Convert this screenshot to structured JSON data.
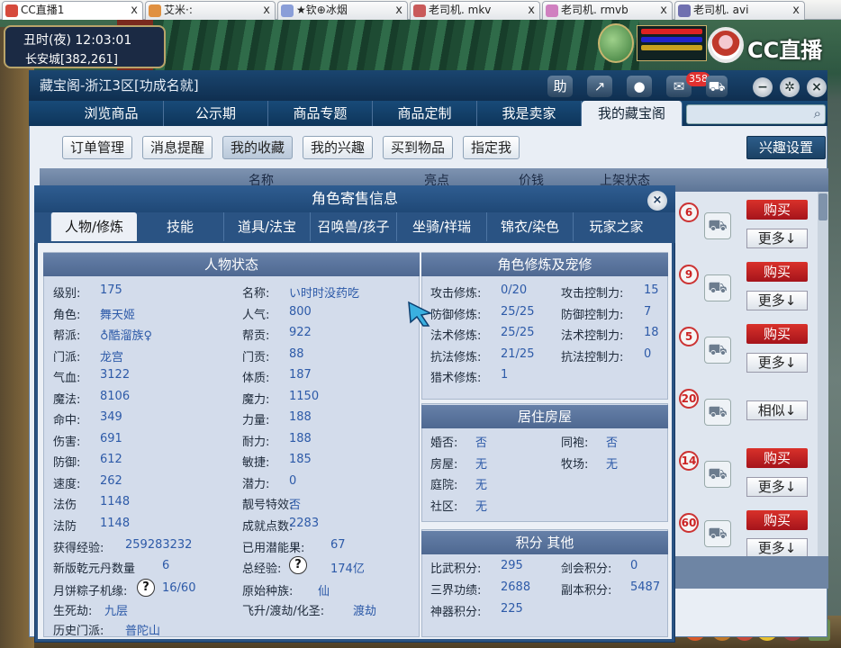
{
  "browser_tabs": [
    {
      "label": "CC直播1",
      "color": "#d64a3c",
      "close": "x"
    },
    {
      "label": "艾米·:",
      "color": "#e09040",
      "close": "x"
    },
    {
      "label": "★钦⊕冰烟",
      "color": "#8a9ed8",
      "close": "x"
    },
    {
      "label": "老司机. mkv",
      "color": "#c95a5a",
      "close": "x"
    },
    {
      "label": "老司机. rmvb",
      "color": "#d080c0",
      "close": "x"
    },
    {
      "label": "老司机. avi",
      "color": "#7070b0",
      "close": "x"
    }
  ],
  "hud": {
    "time": "丑时(夜)  12:03:01",
    "location": "长安城[382,261]",
    "brand": "CC直播"
  },
  "window": {
    "title": "藏宝阁-浙江3区[功成名就]",
    "help_label": "助",
    "message_count": "358",
    "nav_tabs": [
      "浏览商品",
      "公示期",
      "商品专题",
      "商品定制",
      "我是卖家",
      "我的藏宝阁"
    ],
    "sub_buttons": [
      "订单管理",
      "消息提醒",
      "我的收藏",
      "我的兴趣",
      "买到物品",
      "指定我"
    ],
    "interest_settings": "兴趣设置",
    "table_headers": [
      "名称",
      "亮点",
      "价钱",
      "上架状态"
    ],
    "rows": [
      {
        "count": "6",
        "action": "购买",
        "more": "更多↓"
      },
      {
        "count": "9",
        "action": "购买",
        "more": "更多↓"
      },
      {
        "count": "5",
        "action": "购买",
        "more": "更多↓"
      },
      {
        "count": "20",
        "action": "",
        "more": "相似↓"
      },
      {
        "count": "14",
        "action": "购买",
        "more": "更多↓"
      },
      {
        "count": "60",
        "action": "购买",
        "more": "更多↓"
      }
    ]
  },
  "dialog": {
    "title": "角色寄售信息",
    "close": "×",
    "tabs": [
      "人物/修炼",
      "技能",
      "道具/法宝",
      "召唤兽/孩子",
      "坐骑/祥瑞",
      "锦衣/染色",
      "玩家之家"
    ],
    "status_title": "人物状态",
    "status": {
      "col1": [
        {
          "label": "级别:",
          "value": "175"
        },
        {
          "label": "角色:",
          "value": "舞天姬"
        },
        {
          "label": "帮派:",
          "value": "♁酷溜族♀"
        },
        {
          "label": "门派:",
          "value": "龙宫"
        },
        {
          "label": "气血:",
          "value": "3122"
        },
        {
          "label": "魔法:",
          "value": "8106"
        },
        {
          "label": "命中:",
          "value": "349"
        },
        {
          "label": "伤害:",
          "value": "691"
        },
        {
          "label": "防御:",
          "value": "612"
        },
        {
          "label": "速度:",
          "value": "262"
        },
        {
          "label": "法伤",
          "value": "1148"
        },
        {
          "label": "法防",
          "value": "1148"
        }
      ],
      "col2": [
        {
          "label": "名称:",
          "value": "い时时没药吃"
        },
        {
          "label": "人气:",
          "value": "800"
        },
        {
          "label": "帮贡:",
          "value": "922"
        },
        {
          "label": "门贡:",
          "value": "88"
        },
        {
          "label": "体质:",
          "value": "187"
        },
        {
          "label": "魔力:",
          "value": "1150"
        },
        {
          "label": "力量:",
          "value": "188"
        },
        {
          "label": "耐力:",
          "value": "188"
        },
        {
          "label": "敏捷:",
          "value": "185"
        },
        {
          "label": "潜力:",
          "value": "0"
        },
        {
          "label": "靓号特效:",
          "value": "否"
        },
        {
          "label": "成就点数:",
          "value": "2283"
        }
      ],
      "extra": {
        "exp_label": "获得经验:",
        "exp_value": "259283232",
        "potential_label": "已用潜能果:",
        "potential_value": "67",
        "pill_label": "新版乾元丹数量",
        "pill_value": "6",
        "total_exp_label": "总经验:",
        "total_exp_value": "174亿",
        "zongzi_label": "月饼粽子机缘:",
        "zongzi_value": "16/60",
        "race_label": "原始种族:",
        "race_value": "仙",
        "death_label": "生死劫:",
        "death_value": "九层",
        "fly_label": "飞升/渡劫/化圣:",
        "fly_value": "渡劫",
        "history_label": "历史门派:",
        "history_value": "普陀山",
        "help_mark": "?"
      }
    },
    "cultivation_title": "角色修炼及宠修",
    "cultivation": {
      "col1": [
        {
          "label": "攻击修炼:",
          "value": "0/20"
        },
        {
          "label": "防御修炼:",
          "value": "25/25"
        },
        {
          "label": "法术修炼:",
          "value": "25/25"
        },
        {
          "label": "抗法修炼:",
          "value": "21/25"
        },
        {
          "label": "猎术修炼:",
          "value": "1"
        }
      ],
      "col2": [
        {
          "label": "攻击控制力:",
          "value": "15"
        },
        {
          "label": "防御控制力:",
          "value": "7"
        },
        {
          "label": "法术控制力:",
          "value": "18"
        },
        {
          "label": "抗法控制力:",
          "value": "0"
        }
      ]
    },
    "house_title": "居住房屋",
    "house": {
      "col1": [
        {
          "label": "婚否:",
          "value": "否"
        },
        {
          "label": "房屋:",
          "value": "无"
        },
        {
          "label": "庭院:",
          "value": "无"
        },
        {
          "label": "社区:",
          "value": "无"
        }
      ],
      "col2": [
        {
          "label": "同袍:",
          "value": "否"
        },
        {
          "label": "牧场:",
          "value": "无"
        }
      ]
    },
    "points_title": "积分 其他",
    "points": {
      "col1": [
        {
          "label": "比武积分:",
          "value": "295"
        },
        {
          "label": "三界功绩:",
          "value": "2688"
        },
        {
          "label": "神器积分:",
          "value": "225"
        }
      ],
      "col2": [
        {
          "label": "剑会积分:",
          "value": "0"
        },
        {
          "label": "副本积分:",
          "value": "5487"
        }
      ]
    }
  }
}
